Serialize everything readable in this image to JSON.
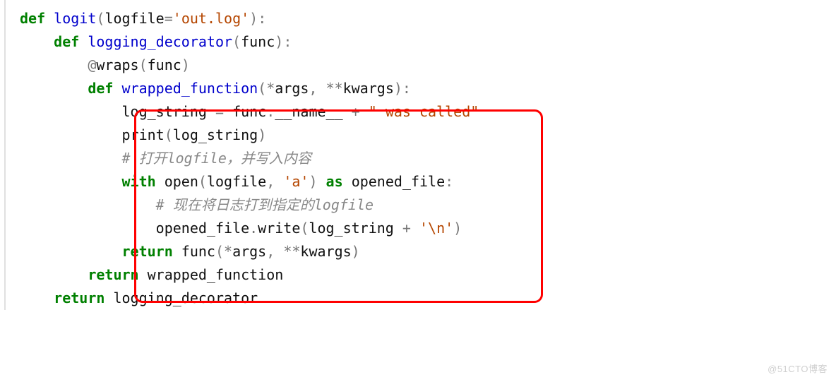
{
  "code": {
    "l1": {
      "kw_def": "def",
      "sp1": " ",
      "fn": "logit",
      "op1": "(",
      "arg": "logfile",
      "op2": "=",
      "str": "'out.log'",
      "op3": ")",
      "op4": ":"
    },
    "l2": {
      "indent": "    ",
      "kw_def": "def",
      "sp1": " ",
      "fn": "logging_decorator",
      "op1": "(",
      "arg": "func",
      "op2": ")",
      "op3": ":"
    },
    "l3": {
      "indent": "        ",
      "at": "@",
      "deco": "wraps",
      "op1": "(",
      "arg": "func",
      "op2": ")"
    },
    "l4": {
      "indent": "        ",
      "kw_def": "def",
      "sp1": " ",
      "fn": "wrapped_function",
      "op1": "(",
      "star": "*",
      "a1": "args",
      "comma": ",",
      "sp2": " ",
      "dstar": "**",
      "a2": "kwargs",
      "op2": ")",
      "op3": ":"
    },
    "l5": {
      "indent": "            ",
      "var": "log_string",
      "sp1": " ",
      "eq": "=",
      "sp2": " ",
      "obj": "func",
      "dot": ".",
      "attr": "__name__",
      "sp3": " ",
      "plus": "+",
      "sp4": " ",
      "str": "\" was called\""
    },
    "l6": {
      "indent": "            ",
      "call": "print",
      "op1": "(",
      "arg": "log_string",
      "op2": ")"
    },
    "l7": {
      "indent": "            ",
      "hash": "# ",
      "txt": "打开logfile，并写入内容"
    },
    "l8": {
      "indent": "            ",
      "kw_with": "with",
      "sp1": " ",
      "call": "open",
      "op1": "(",
      "a1": "logfile",
      "comma": ",",
      "sp2": " ",
      "str": "'a'",
      "op2": ")",
      "sp3": " ",
      "kw_as": "as",
      "sp4": " ",
      "a2": "opened_file",
      "op3": ":"
    },
    "l9": {
      "indent": "                ",
      "hash": "# ",
      "txt": "现在将日志打到指定的logfile"
    },
    "l10": {
      "indent": "                ",
      "obj": "opened_file",
      "dot": ".",
      "meth": "write",
      "op1": "(",
      "a1": "log_string",
      "sp1": " ",
      "plus": "+",
      "sp2": " ",
      "str": "'\\n'",
      "op2": ")"
    },
    "l11": {
      "indent": "            ",
      "kw": "return",
      "sp1": " ",
      "call": "func",
      "op1": "(",
      "star": "*",
      "a1": "args",
      "comma": ",",
      "sp2": " ",
      "dstar": "**",
      "a2": "kwargs",
      "op2": ")"
    },
    "l12": {
      "indent": "        ",
      "kw": "return",
      "sp1": " ",
      "id": "wrapped_function"
    },
    "l13": {
      "indent": "    ",
      "kw": "return",
      "sp1": " ",
      "id": "logging_decorator"
    }
  },
  "watermark": "@51CTO博客"
}
